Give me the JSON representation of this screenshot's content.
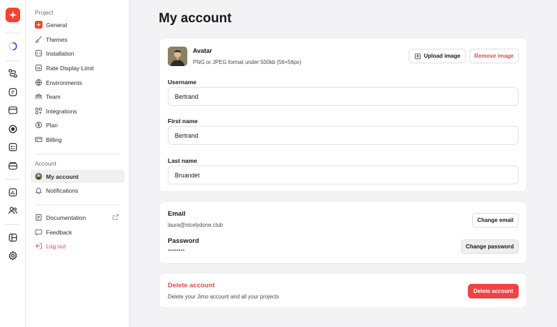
{
  "sidebar": {
    "project_label": "Project",
    "project_items": [
      {
        "label": "General",
        "icon": "jimo-logo-icon"
      },
      {
        "label": "Themes",
        "icon": "brush-icon"
      },
      {
        "label": "Installation",
        "icon": "code-icon"
      },
      {
        "label": "Rate Display Limit",
        "icon": "gauge-icon"
      },
      {
        "label": "Environments",
        "icon": "globe-icon"
      },
      {
        "label": "Team",
        "icon": "team-icon"
      },
      {
        "label": "Integrations",
        "icon": "integrations-icon"
      },
      {
        "label": "Plan",
        "icon": "dollar-icon"
      },
      {
        "label": "Billing",
        "icon": "credit-card-icon"
      }
    ],
    "account_label": "Account",
    "account_items": [
      {
        "label": "My account",
        "icon": "avatar"
      },
      {
        "label": "Notifications",
        "icon": "bell-icon"
      }
    ],
    "bottom_items": [
      {
        "label": "Documentation",
        "icon": "document-icon"
      },
      {
        "label": "Feedback",
        "icon": "feedback-icon"
      },
      {
        "label": "Log out",
        "icon": "logout-icon"
      }
    ]
  },
  "main": {
    "title": "My account",
    "avatar": {
      "label": "Avatar",
      "hint": "PNG or JPEG format under 500kb (56×56px)",
      "upload_label": "Upload image",
      "remove_label": "Remove image"
    },
    "username": {
      "label": "Username",
      "value": "Bertrand"
    },
    "first_name": {
      "label": "First name",
      "value": "Bertrand"
    },
    "last_name": {
      "label": "Last name",
      "value": "Bruandet"
    },
    "email": {
      "label": "Email",
      "value": "laura@nicelydone.club",
      "button": "Change email"
    },
    "password": {
      "label": "Password",
      "value": "********",
      "button": "Change password"
    },
    "delete": {
      "label": "Delete account",
      "description": "Delete your Jimo account and all your projects",
      "button": "Delete account"
    }
  },
  "colors": {
    "brand": "#f4442e",
    "danger": "#e5484d",
    "background": "#f3f3f5"
  }
}
